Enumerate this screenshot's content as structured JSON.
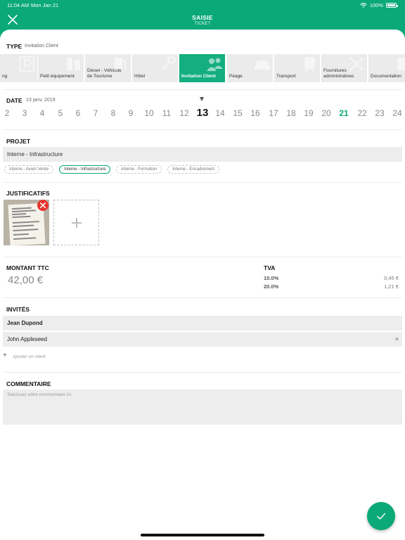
{
  "status_bar": {
    "time": "11:04 AM",
    "date": "Mon Jan 21",
    "battery": "100%",
    "battery_level": 1.0
  },
  "header": {
    "title": "SAISIE",
    "subtitle": "TICKET"
  },
  "type": {
    "label": "TYPE",
    "selected": "Invitation Client",
    "items": [
      {
        "label": "ng",
        "icon": "parking-icon"
      },
      {
        "label": "Petit équipement",
        "icon": "tools-icon"
      },
      {
        "label": "Diesel - Véhicule\nde Tourisme",
        "icon": "fuel-pump-icon"
      },
      {
        "label": "Hôtel",
        "icon": "key-icon"
      },
      {
        "label": "Invitation Client",
        "icon": "people-icon",
        "selected": true
      },
      {
        "label": "Péage",
        "icon": "car-icon"
      },
      {
        "label": "Transport",
        "icon": "train-icon"
      },
      {
        "label": "Fournitures\nadministratives",
        "icon": "scissors-icon"
      },
      {
        "label": "Documentation",
        "icon": "book-icon"
      }
    ]
  },
  "date": {
    "label": "DATE",
    "value": "13 janv. 2019",
    "days": [
      "2",
      "3",
      "4",
      "5",
      "6",
      "7",
      "8",
      "9",
      "10",
      "11",
      "12",
      "13",
      "14",
      "15",
      "16",
      "17",
      "18",
      "19",
      "20",
      "21",
      "22",
      "23",
      "24"
    ],
    "selected_day": "13",
    "today_day": "21"
  },
  "projet": {
    "label": "PROJET",
    "value": "Interne - Infrastructure",
    "chips": [
      {
        "label": "Interne - Avant Vente"
      },
      {
        "label": "Interne - Infrastructure",
        "selected": true
      },
      {
        "label": "Interne - Formation"
      },
      {
        "label": "Interne - Encadrement"
      }
    ]
  },
  "justificatifs": {
    "label": "JUSTIFICATIFS",
    "receipt_icon": "receipt-thumbnail",
    "remove_icon": "remove-icon",
    "add_icon": "plus-icon"
  },
  "montant": {
    "label": "MONTANT TTC",
    "value": "42,00 €"
  },
  "tva": {
    "label": "TVA",
    "rows": [
      {
        "rate": "10.0%",
        "amount": "0,45 €"
      },
      {
        "rate": "20.0%",
        "amount": "1,21 €"
      }
    ]
  },
  "invites": {
    "label": "INVITÉS",
    "primary": "Jean Dupond",
    "guests": [
      {
        "name": "John Appleseed",
        "remove": "×"
      }
    ],
    "add_label": "+",
    "add_placeholder": "Ajouter un client"
  },
  "commentaire": {
    "label": "COMMENTAIRE",
    "placeholder": "Saisissez votre commentaire ici"
  },
  "colors": {
    "accent": "#0aa977",
    "selected_card": "#14ae80",
    "field_bg": "#ededed",
    "danger": "#e8332e"
  }
}
